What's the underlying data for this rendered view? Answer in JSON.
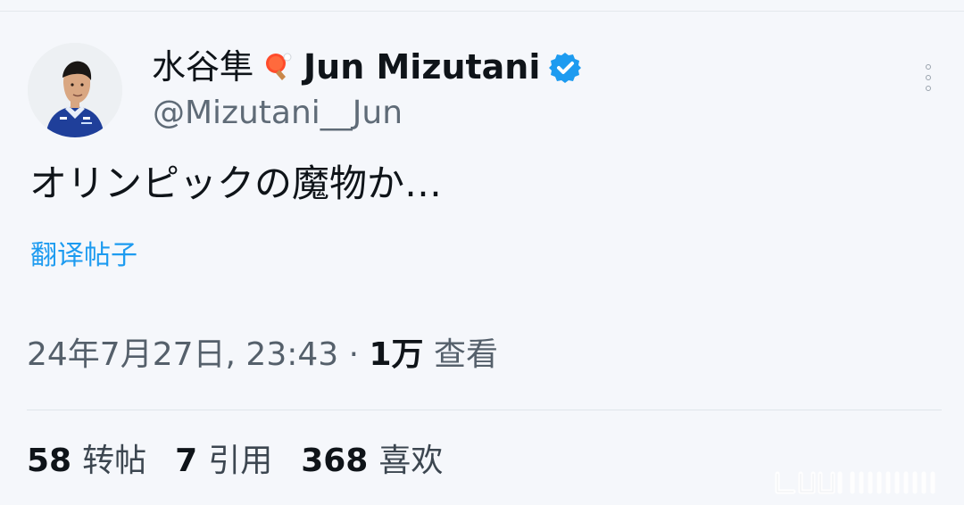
{
  "post": {
    "author": {
      "name_kanji": "水谷隼",
      "name_latin": "Jun Mizutani",
      "handle": "@Mizutani__Jun",
      "avatar_icon": "athlete-avatar",
      "name_icon": "ping-pong-paddle-icon",
      "verified_icon": "verified-badge-icon",
      "verified_color": "#1d9bf0"
    },
    "text": "オリンピックの魔物か…",
    "translate_label": "翻译帖子",
    "meta": {
      "timestamp": "24年7月27日, 23:43 · ",
      "views_count": "1万",
      "views_label": " 查看"
    },
    "stats": [
      {
        "value": "58",
        "label": "转帖"
      },
      {
        "value": "7",
        "label": "引用"
      },
      {
        "value": "368",
        "label": "喜欢"
      }
    ],
    "more_icon": "more-options-icon"
  },
  "colors": {
    "background": "#f5f7fb",
    "text": "#0f1419",
    "secondary": "#5f6b77",
    "link": "#1d9bf0",
    "divider": "#dfe5ea"
  }
}
